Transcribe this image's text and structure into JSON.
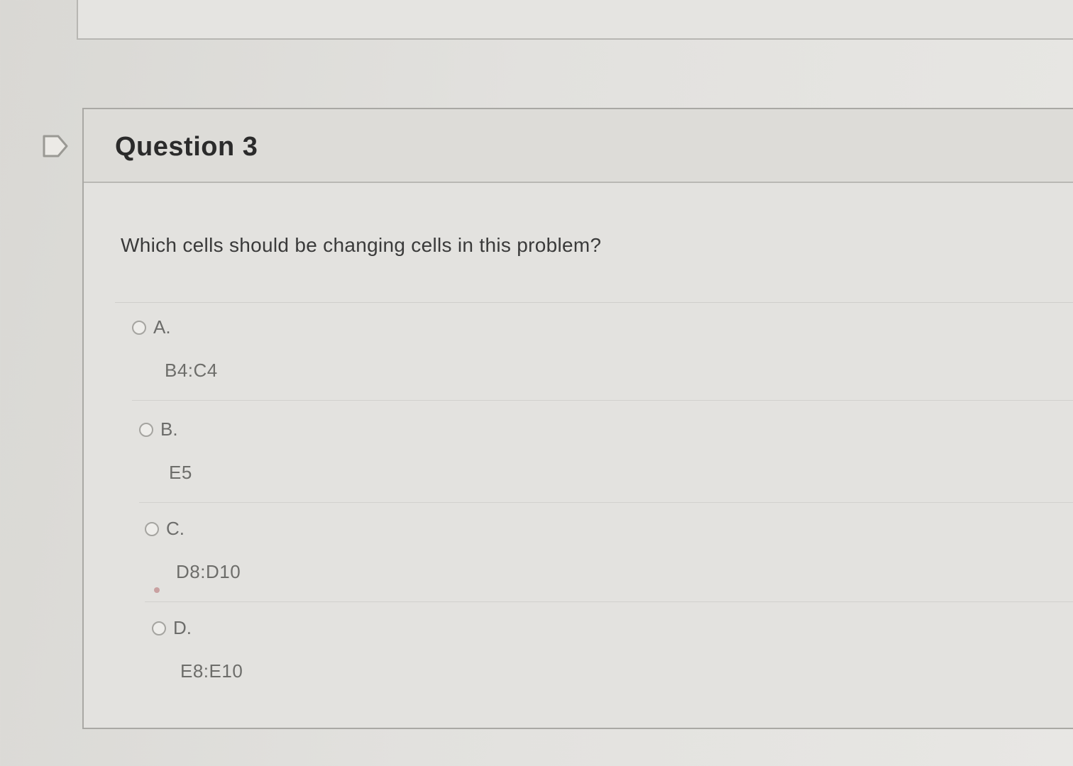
{
  "question": {
    "title": "Question 3",
    "prompt": "Which cells should be changing cells in this problem?",
    "options": [
      {
        "letter": "A.",
        "value": "B4:C4"
      },
      {
        "letter": "B.",
        "value": "E5"
      },
      {
        "letter": "C.",
        "value": "D8:D10"
      },
      {
        "letter": "D.",
        "value": "E8:E10"
      }
    ]
  },
  "icons": {
    "flag": "flag-icon"
  }
}
